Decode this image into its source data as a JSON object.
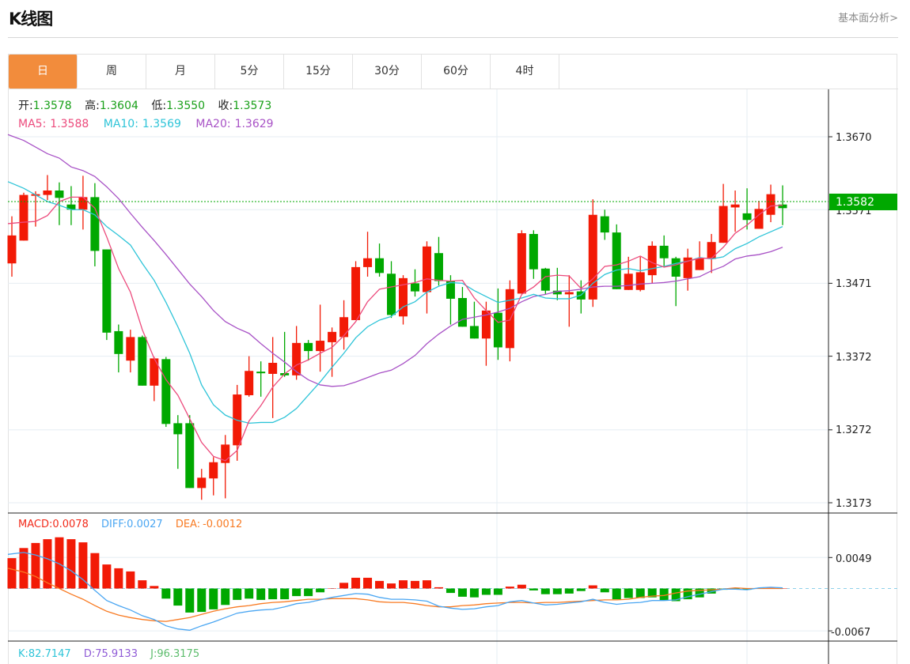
{
  "header": {
    "title": "K线图",
    "link": "基本面分析>"
  },
  "tabs": [
    {
      "label": "日",
      "active": true
    },
    {
      "label": "周"
    },
    {
      "label": "月"
    },
    {
      "label": "5分"
    },
    {
      "label": "15分"
    },
    {
      "label": "30分"
    },
    {
      "label": "60分"
    },
    {
      "label": "4时"
    }
  ],
  "legend": {
    "open_label": "开:",
    "open": "1.3578",
    "high_label": "高:",
    "high": "1.3604",
    "low_label": "低:",
    "low": "1.3550",
    "close_label": "收:",
    "close": "1.3573",
    "ma5_label": "MA5:",
    "ma5": "1.3588",
    "ma10_label": "MA10:",
    "ma10": "1.3569",
    "ma20_label": "MA20:",
    "ma20": "1.3629",
    "macd_label": "MACD:",
    "macd": "0.0078",
    "diff_label": "DIFF:",
    "diff": "0.0027",
    "dea_label": "DEA:",
    "dea": "-0.0012",
    "k_label": "K:",
    "k": "82.7147",
    "d_label": "D:",
    "d": "75.9133",
    "j_label": "J:",
    "j": "96.3175"
  },
  "colors": {
    "up": "#f21a06",
    "down": "#00a800",
    "ma5": "#ec4a7c",
    "ma10": "#2ec4d8",
    "ma20": "#a852c6",
    "diff": "#4aa6f2",
    "dea": "#f87a22",
    "macd_text": "#f22a1a",
    "k": "#2ec4d8",
    "d": "#8f5ad6",
    "j": "#5cbc6c",
    "last_price": "#00a800",
    "tab_active": "#f28c3c"
  },
  "chart_data": [
    {
      "type": "candlestick",
      "ylim": [
        1.3173,
        1.367
      ],
      "y_ticks": [
        "1.3670",
        "1.3571",
        "1.3471",
        "1.3372",
        "1.3272",
        "1.3173"
      ],
      "last_price": "1.3582",
      "ohlc": [
        [
          1.3498,
          1.3562,
          1.348,
          1.3536
        ],
        [
          1.3529,
          1.3594,
          1.3529,
          1.3591
        ],
        [
          1.3591,
          1.3596,
          1.3548,
          1.3592
        ],
        [
          1.3591,
          1.3618,
          1.3584,
          1.3597
        ],
        [
          1.3597,
          1.3608,
          1.355,
          1.3587
        ],
        [
          1.3578,
          1.3603,
          1.355,
          1.3571
        ],
        [
          1.3571,
          1.3617,
          1.3544,
          1.3588
        ],
        [
          1.3588,
          1.3607,
          1.3494,
          1.3515
        ],
        [
          1.3517,
          1.3517,
          1.3394,
          1.3404
        ],
        [
          1.3406,
          1.3415,
          1.335,
          1.3375
        ],
        [
          1.3366,
          1.3408,
          1.335,
          1.3398
        ],
        [
          1.3398,
          1.34,
          1.3332,
          1.3332
        ],
        [
          1.3332,
          1.3371,
          1.3311,
          1.3369
        ],
        [
          1.3368,
          1.3371,
          1.3276,
          1.328
        ],
        [
          1.3281,
          1.3292,
          1.3219,
          1.3266
        ],
        [
          1.3281,
          1.3292,
          1.3193,
          1.3193
        ],
        [
          1.3193,
          1.3219,
          1.3177,
          1.3207
        ],
        [
          1.3206,
          1.3235,
          1.3183,
          1.3228
        ],
        [
          1.3227,
          1.3265,
          1.3179,
          1.3252
        ],
        [
          1.3251,
          1.3333,
          1.323,
          1.332
        ],
        [
          1.3319,
          1.3372,
          1.3317,
          1.3352
        ],
        [
          1.3351,
          1.3365,
          1.3317,
          1.3349
        ],
        [
          1.3348,
          1.3398,
          1.3288,
          1.3363
        ],
        [
          1.3349,
          1.3405,
          1.3344,
          1.3346
        ],
        [
          1.3346,
          1.3413,
          1.334,
          1.339
        ],
        [
          1.339,
          1.3394,
          1.3366,
          1.3379
        ],
        [
          1.3379,
          1.3442,
          1.3351,
          1.3393
        ],
        [
          1.3391,
          1.3411,
          1.3344,
          1.3405
        ],
        [
          1.3398,
          1.3448,
          1.3381,
          1.3425
        ],
        [
          1.3421,
          1.3501,
          1.3421,
          1.3493
        ],
        [
          1.3493,
          1.3541,
          1.348,
          1.3505
        ],
        [
          1.3505,
          1.3525,
          1.348,
          1.3485
        ],
        [
          1.3484,
          1.3501,
          1.3424,
          1.3428
        ],
        [
          1.3426,
          1.3482,
          1.3415,
          1.3478
        ],
        [
          1.3471,
          1.349,
          1.3453,
          1.346
        ],
        [
          1.3459,
          1.3528,
          1.343,
          1.3521
        ],
        [
          1.3512,
          1.3534,
          1.3468,
          1.3474
        ],
        [
          1.3474,
          1.3482,
          1.3415,
          1.345
        ],
        [
          1.3451,
          1.3466,
          1.3412,
          1.3412
        ],
        [
          1.3413,
          1.3446,
          1.3396,
          1.3396
        ],
        [
          1.3396,
          1.3446,
          1.3359,
          1.3434
        ],
        [
          1.3431,
          1.3464,
          1.3367,
          1.3384
        ],
        [
          1.3383,
          1.3475,
          1.3365,
          1.3463
        ],
        [
          1.3457,
          1.3543,
          1.3457,
          1.3539
        ],
        [
          1.3538,
          1.3543,
          1.3477,
          1.349
        ],
        [
          1.3491,
          1.3492,
          1.3456,
          1.3461
        ],
        [
          1.3461,
          1.3492,
          1.3448,
          1.3456
        ],
        [
          1.3456,
          1.3482,
          1.3412,
          1.3459
        ],
        [
          1.346,
          1.3475,
          1.343,
          1.3449
        ],
        [
          1.3449,
          1.3585,
          1.3439,
          1.3564
        ],
        [
          1.3562,
          1.3571,
          1.353,
          1.354
        ],
        [
          1.354,
          1.3551,
          1.3463,
          1.3463
        ],
        [
          1.3462,
          1.3507,
          1.3462,
          1.3484
        ],
        [
          1.3462,
          1.3507,
          1.346,
          1.3486
        ],
        [
          1.3482,
          1.3528,
          1.3471,
          1.3522
        ],
        [
          1.3522,
          1.3536,
          1.3494,
          1.3505
        ],
        [
          1.3505,
          1.3507,
          1.344,
          1.348
        ],
        [
          1.3478,
          1.3518,
          1.3461,
          1.3506
        ],
        [
          1.3489,
          1.3528,
          1.3489,
          1.3505
        ],
        [
          1.3504,
          1.3538,
          1.3485,
          1.3527
        ],
        [
          1.3526,
          1.3606,
          1.3526,
          1.3576
        ],
        [
          1.3574,
          1.3597,
          1.3541,
          1.3578
        ],
        [
          1.3566,
          1.36,
          1.3544,
          1.3557
        ],
        [
          1.3545,
          1.3583,
          1.3545,
          1.3572
        ],
        [
          1.3564,
          1.3605,
          1.3554,
          1.3592
        ],
        [
          1.3578,
          1.3604,
          1.355,
          1.3573
        ]
      ],
      "ma5": [
        1.3552,
        1.3554,
        1.3555,
        1.3563,
        1.3582,
        1.3588,
        1.3588,
        1.3573,
        1.3534,
        1.3491,
        1.3459,
        1.3408,
        1.3369,
        1.334,
        1.3319,
        1.3287,
        1.3255,
        1.3236,
        1.323,
        1.3244,
        1.3284,
        1.3305,
        1.333,
        1.3348,
        1.336,
        1.3367,
        1.3376,
        1.3384,
        1.34,
        1.3419,
        1.3446,
        1.3463,
        1.3466,
        1.3469,
        1.3472,
        1.3477,
        1.3475,
        1.3474,
        1.3475,
        1.3451,
        1.3434,
        1.3418,
        1.3421,
        1.3456,
        1.3466,
        1.348,
        1.3482,
        1.3481,
        1.3464,
        1.3477,
        1.3494,
        1.3496,
        1.3501,
        1.3508,
        1.3499,
        1.3493,
        1.3496,
        1.3501,
        1.3505,
        1.3505,
        1.352,
        1.3539,
        1.355,
        1.3564,
        1.3576,
        1.3577
      ],
      "ma10": [
        1.3609,
        1.36,
        1.3591,
        1.3582,
        1.3577,
        1.3571,
        1.3571,
        1.3564,
        1.3548,
        1.3536,
        1.3523,
        1.3498,
        1.3475,
        1.3445,
        1.3412,
        1.3376,
        1.3333,
        1.3306,
        1.3292,
        1.3285,
        1.3281,
        1.3282,
        1.3282,
        1.3289,
        1.3301,
        1.3319,
        1.3337,
        1.3357,
        1.3376,
        1.3397,
        1.3412,
        1.3421,
        1.3426,
        1.3439,
        1.3446,
        1.3459,
        1.3467,
        1.3472,
        1.3471,
        1.3461,
        1.3453,
        1.3445,
        1.3448,
        1.3451,
        1.3456,
        1.3451,
        1.345,
        1.345,
        1.3455,
        1.3471,
        1.3483,
        1.3489,
        1.3491,
        1.3488,
        1.3491,
        1.3494,
        1.3498,
        1.3501,
        1.3506,
        1.3504,
        1.3507,
        1.3518,
        1.3525,
        1.3534,
        1.3541,
        1.3548
      ],
      "ma20": [
        1.3673,
        1.3665,
        1.3656,
        1.3647,
        1.3641,
        1.3629,
        1.3624,
        1.3616,
        1.3602,
        1.3586,
        1.3566,
        1.3547,
        1.3529,
        1.351,
        1.349,
        1.347,
        1.3453,
        1.3434,
        1.3419,
        1.341,
        1.3403,
        1.3389,
        1.3376,
        1.3364,
        1.3351,
        1.334,
        1.3333,
        1.3331,
        1.3332,
        1.3337,
        1.3343,
        1.3349,
        1.3353,
        1.3362,
        1.3373,
        1.3389,
        1.3402,
        1.3413,
        1.3422,
        1.3425,
        1.3428,
        1.3432,
        1.3437,
        1.3446,
        1.3453,
        1.3456,
        1.346,
        1.3461,
        1.3463,
        1.3466,
        1.3467,
        1.3467,
        1.3468,
        1.347,
        1.3471,
        1.3472,
        1.3474,
        1.3477,
        1.348,
        1.3488,
        1.3494,
        1.3504,
        1.3508,
        1.351,
        1.3514,
        1.352
      ]
    },
    {
      "type": "macd",
      "y_ticks": [
        "0.0049",
        "-0.0067"
      ],
      "macd": [
        0.0048,
        0.0064,
        0.0072,
        0.0078,
        0.0081,
        0.0078,
        0.0073,
        0.0056,
        0.0038,
        0.0032,
        0.0027,
        0.0013,
        0.0004,
        -0.0016,
        -0.0027,
        -0.0038,
        -0.0037,
        -0.0033,
        -0.0026,
        -0.0018,
        -0.0016,
        -0.0018,
        -0.0017,
        -0.0017,
        -0.0012,
        -0.0012,
        -0.0006,
        0.0,
        0.0009,
        0.0017,
        0.0017,
        0.0012,
        0.0008,
        0.0013,
        0.0012,
        0.0013,
        0.0002,
        -0.0007,
        -0.0013,
        -0.0014,
        -0.001,
        -0.001,
        0.0003,
        0.0006,
        -0.0003,
        -0.0009,
        -0.0009,
        -0.0008,
        -0.0004,
        0.0005,
        -0.0006,
        -0.0017,
        -0.0015,
        -0.0015,
        -0.0014,
        -0.0019,
        -0.002,
        -0.0017,
        -0.0014,
        -0.0008,
        -0.0002,
        -0.0001,
        -0.0002,
        0.0,
        0.0001,
        0.0
      ],
      "diff": [
        0.0054,
        0.0057,
        0.0053,
        0.0047,
        0.0039,
        0.0028,
        0.0014,
        -0.0003,
        -0.0019,
        -0.0027,
        -0.0034,
        -0.0043,
        -0.0049,
        -0.0059,
        -0.0064,
        -0.0066,
        -0.0059,
        -0.0053,
        -0.0046,
        -0.0039,
        -0.0036,
        -0.0034,
        -0.0033,
        -0.0029,
        -0.0024,
        -0.0022,
        -0.0018,
        -0.0014,
        -0.0011,
        -0.0008,
        -0.0009,
        -0.0014,
        -0.0017,
        -0.0017,
        -0.0018,
        -0.002,
        -0.0028,
        -0.0031,
        -0.0033,
        -0.0032,
        -0.0029,
        -0.0027,
        -0.0021,
        -0.0019,
        -0.0023,
        -0.0026,
        -0.0025,
        -0.0023,
        -0.0021,
        -0.0017,
        -0.0022,
        -0.0025,
        -0.0023,
        -0.0022,
        -0.0019,
        -0.0019,
        -0.0018,
        -0.0013,
        -0.0009,
        -0.0005,
        -0.0001,
        -0.0001,
        -0.0002,
        0.0001,
        0.0002,
        0.0001
      ],
      "dea": [
        0.0032,
        0.0026,
        0.0019,
        0.0009,
        0.0,
        -0.0009,
        -0.0017,
        -0.0027,
        -0.0036,
        -0.0042,
        -0.0046,
        -0.0049,
        -0.0051,
        -0.0052,
        -0.0049,
        -0.0046,
        -0.0041,
        -0.0036,
        -0.0032,
        -0.0029,
        -0.0027,
        -0.0024,
        -0.0022,
        -0.0021,
        -0.0019,
        -0.0017,
        -0.0017,
        -0.0016,
        -0.0016,
        -0.0016,
        -0.0018,
        -0.0021,
        -0.0022,
        -0.0022,
        -0.0024,
        -0.0027,
        -0.0029,
        -0.0029,
        -0.0027,
        -0.0026,
        -0.0024,
        -0.0023,
        -0.0022,
        -0.0022,
        -0.0023,
        -0.0022,
        -0.0022,
        -0.0021,
        -0.002,
        -0.0019,
        -0.0018,
        -0.0018,
        -0.0017,
        -0.0014,
        -0.0012,
        -0.0011,
        -0.0007,
        -0.0004,
        -0.0003,
        -0.0002,
        -0.0001,
        0.0001,
        0.0,
        0.0,
        0.0,
        0.0
      ]
    }
  ]
}
